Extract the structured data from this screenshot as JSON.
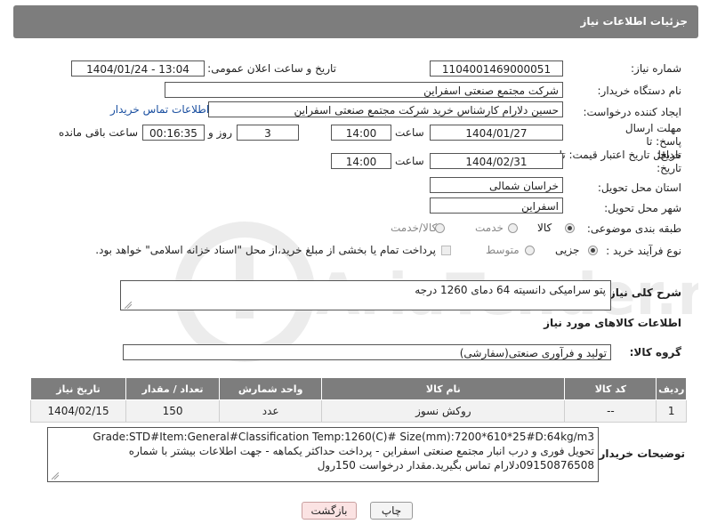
{
  "header": {
    "title": "جزئیات اطلاعات نیاز"
  },
  "fields": {
    "need_number_label": "شماره نیاز:",
    "need_number": "1104001469000051",
    "announce_label": "تاریخ و ساعت اعلان عمومی:",
    "announce_value": "1404/01/24 - 13:04",
    "buyer_org_label": "نام دستگاه خریدار:",
    "buyer_org": "شرکت مجتمع صنعتی اسفراین",
    "requester_label": "ایجاد کننده درخواست:",
    "requester": "حسین دلارام کارشناس خرید شرکت مجتمع صنعتی اسفراین",
    "buyer_contact_link": "اطلاعات تماس خریدار",
    "deadline_label": "مهلت ارسال پاسخ: تا تاریخ:",
    "deadline_date": "1404/01/27",
    "time_label": "ساعت",
    "deadline_time": "14:00",
    "days_value": "3",
    "days_label": "روز و",
    "remaining_time": "00:16:35",
    "remaining_label": "ساعت باقی مانده",
    "validity_label": "حداقل تاریخ اعتبار قیمت: تا تاریخ:",
    "validity_date": "1404/02/31",
    "validity_time": "14:00",
    "province_label": "استان محل تحویل:",
    "province": "خراسان شمالی",
    "city_label": "شهر محل تحویل:",
    "city": "اسفراین",
    "category_label": "طبقه بندی موضوعی:",
    "category_options": [
      "کالا",
      "خدمت",
      "کالا/خدمت"
    ],
    "process_label": "نوع فرآیند خرید :",
    "process_options": [
      "جزیی",
      "متوسط"
    ],
    "process_note": "پرداخت تمام یا بخشی از مبلغ خرید،از محل \"اسناد خزانه اسلامی\" خواهد بود.",
    "description_label": "شرح کلی نیاز:",
    "description": "پتو سرامیکی دانسیته 64 دمای 1260 درجه",
    "goods_info_title": "اطلاعات کالاهای مورد نیاز",
    "goods_group_label": "گروه کالا:",
    "goods_group": "تولید و فرآوری صنعتی(سفارشی)",
    "buyer_notes_label": "توضیحات خریدار:",
    "buyer_notes_lines": [
      "Grade:STD#Item:General#Classification Temp:1260(C)# Size(mm):7200*610*25#D:64kg/m3",
      "تحویل فوری و درب انبار مجتمع صنعتی اسفراین - پرداخت حداکثر یکماهه - جهت اطلاعات بیشتر با شماره",
      "09150876508دلارام  تماس بگیرید.مقدار درخواست 150رول"
    ]
  },
  "table": {
    "headers": [
      "ردیف",
      "کد کالا",
      "نام کالا",
      "واحد شمارش",
      "تعداد / مقدار",
      "تاریخ نیاز"
    ],
    "rows": [
      [
        "1",
        "--",
        "روکش نسوز",
        "عدد",
        "150",
        "1404/02/15"
      ]
    ]
  },
  "buttons": {
    "print": "چاپ",
    "back": "بازگشت"
  },
  "watermark": {
    "text": "AriaTender.neT"
  },
  "colors": {
    "header_bg": "#7d7d7d",
    "link": "#1a4fa0",
    "back_button_bg": "#fbe3e3"
  }
}
